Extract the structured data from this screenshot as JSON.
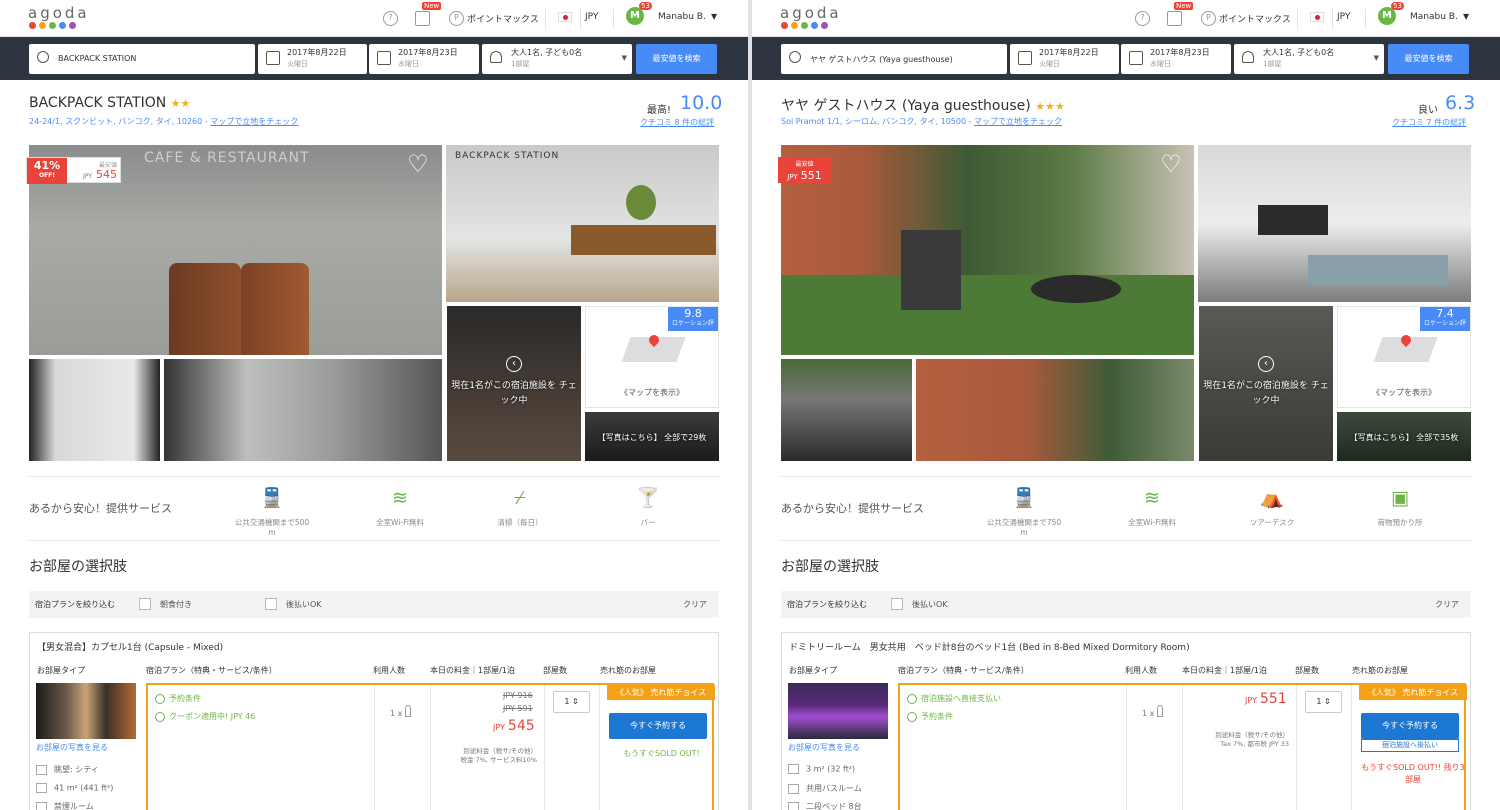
{
  "common": {
    "logo": "agoda",
    "logo_dot_colors": [
      "#e8443a",
      "#f3a217",
      "#6cb645",
      "#488bf8",
      "#a04ed0"
    ],
    "nav_new_badge": "New",
    "nav_points": "ポイントマックス",
    "nav_currency": "JPY",
    "user_name": "Manabu B.",
    "user_initial": "M",
    "user_badge": "53",
    "checkin_date": "2017年8月22日",
    "checkin_day": "火曜日",
    "checkout_date": "2017年8月23日",
    "checkout_day": "水曜日",
    "guests": "大人1名, 子ども0名",
    "rooms": "1部屋",
    "search_button": "最安値を検索",
    "map_show": "《マップを表示》",
    "viewing_now": "現在1名がこの宿泊施設を チェック中",
    "services_title": "あるから安心！提供サービス",
    "rooms_title": "お部屋の選択肢",
    "filter_title": "宿泊プランを絞り込む",
    "filter_clear": "クリア",
    "col_room_type": "お部屋タイプ",
    "col_plan": "宿泊プラン（特典・サービス/条件）",
    "col_occupancy": "利用人数",
    "col_price": "本日の料金｜1部屋/1泊",
    "col_rooms": "部屋数",
    "col_popular": "売れ筋のお部屋",
    "more_photos": "お部屋の写真を見る",
    "popular_choice": "《人気》 売れ筋チョイス",
    "book_now": "今すぐ予約する",
    "occupancy_value": "1 x",
    "room_count": "1",
    "cheapest_label": "最安値",
    "location_score_label": "ロケーション評",
    "tax_label": "別途料金（税サ/その他）"
  },
  "left": {
    "search_query": "BACKPACK STATION",
    "hotel_name": "BACKPACK STATION",
    "stars": "★★",
    "address": "24-24/1, スクンビット, バンコク, タイ, 10260 - ",
    "map_link": "マップで立地をチェック",
    "score_label": "最高!",
    "score": "10.0",
    "reviews": "クチコミ 8 件の総評",
    "discount": "41%",
    "discount_sub": "OFF!",
    "price_currency": "JPY",
    "price": "545",
    "location_score": "9.8",
    "photo_more": "【写真はこちら】 全部で29枚",
    "sign_text": "CAFE & RESTAURANT",
    "sign2_text": "BACKPACK STATION",
    "services": [
      "公共交通機関まで500 m",
      "全室Wi-Fi無料",
      "清掃（毎日）",
      "バー"
    ],
    "filters": [
      "朝食付き",
      "後払いOK"
    ],
    "room_name": "【男女混合】カプセル1台 (Capsule - Mixed)",
    "features": [
      "眺望: シティ",
      "41 m² (441 ft²)",
      "禁煙ルーム"
    ],
    "conditions": [
      "予約条件",
      "クーポン適用中! JPY 46"
    ],
    "old_price1": "JPY 916",
    "old_price2": "JPY 591",
    "final_price": "545",
    "tax_note": "税金 7%, サービス料10%",
    "soldout": "もうすぐSOLD OUT!"
  },
  "right": {
    "search_query": "ヤヤ ゲストハウス (Yaya guesthouse)",
    "hotel_name": "ヤヤ ゲストハウス (Yaya guesthouse)",
    "stars": "★★★",
    "address": "Soi Pramot 1/1, シーロム, バンコク, タイ, 10500 - ",
    "map_link": "マップで立地をチェック",
    "score_label": "良い",
    "score": "6.3",
    "reviews": "クチコミ 7 件の総評",
    "price_currency": "JPY",
    "price": "551",
    "location_score": "7.4",
    "photo_more": "【写真はこちら】 全部で35枚",
    "services": [
      "公共交通機関まで750 m",
      "全室Wi-Fi無料",
      "ツアーデスク",
      "荷物預かり所"
    ],
    "filters": [
      "後払いOK"
    ],
    "room_name": "ドミトリールーム　男女共用　ベッド計8台のベッド1台 (Bed in 8-Bed Mixed Dormitory Room)",
    "features": [
      "3 m² (32 ft²)",
      "共用バスルーム",
      "二段ベッド 8台"
    ],
    "conditions": [
      "宿泊施設へ直接支払い",
      "予約条件"
    ],
    "final_price": "551",
    "tax_note": "Tax 7%, 都市税 JPY 33",
    "pay_later": "宿泊施設へ後払い",
    "soldout": "もうすぐSOLD OUT!! 残り3部屋"
  }
}
